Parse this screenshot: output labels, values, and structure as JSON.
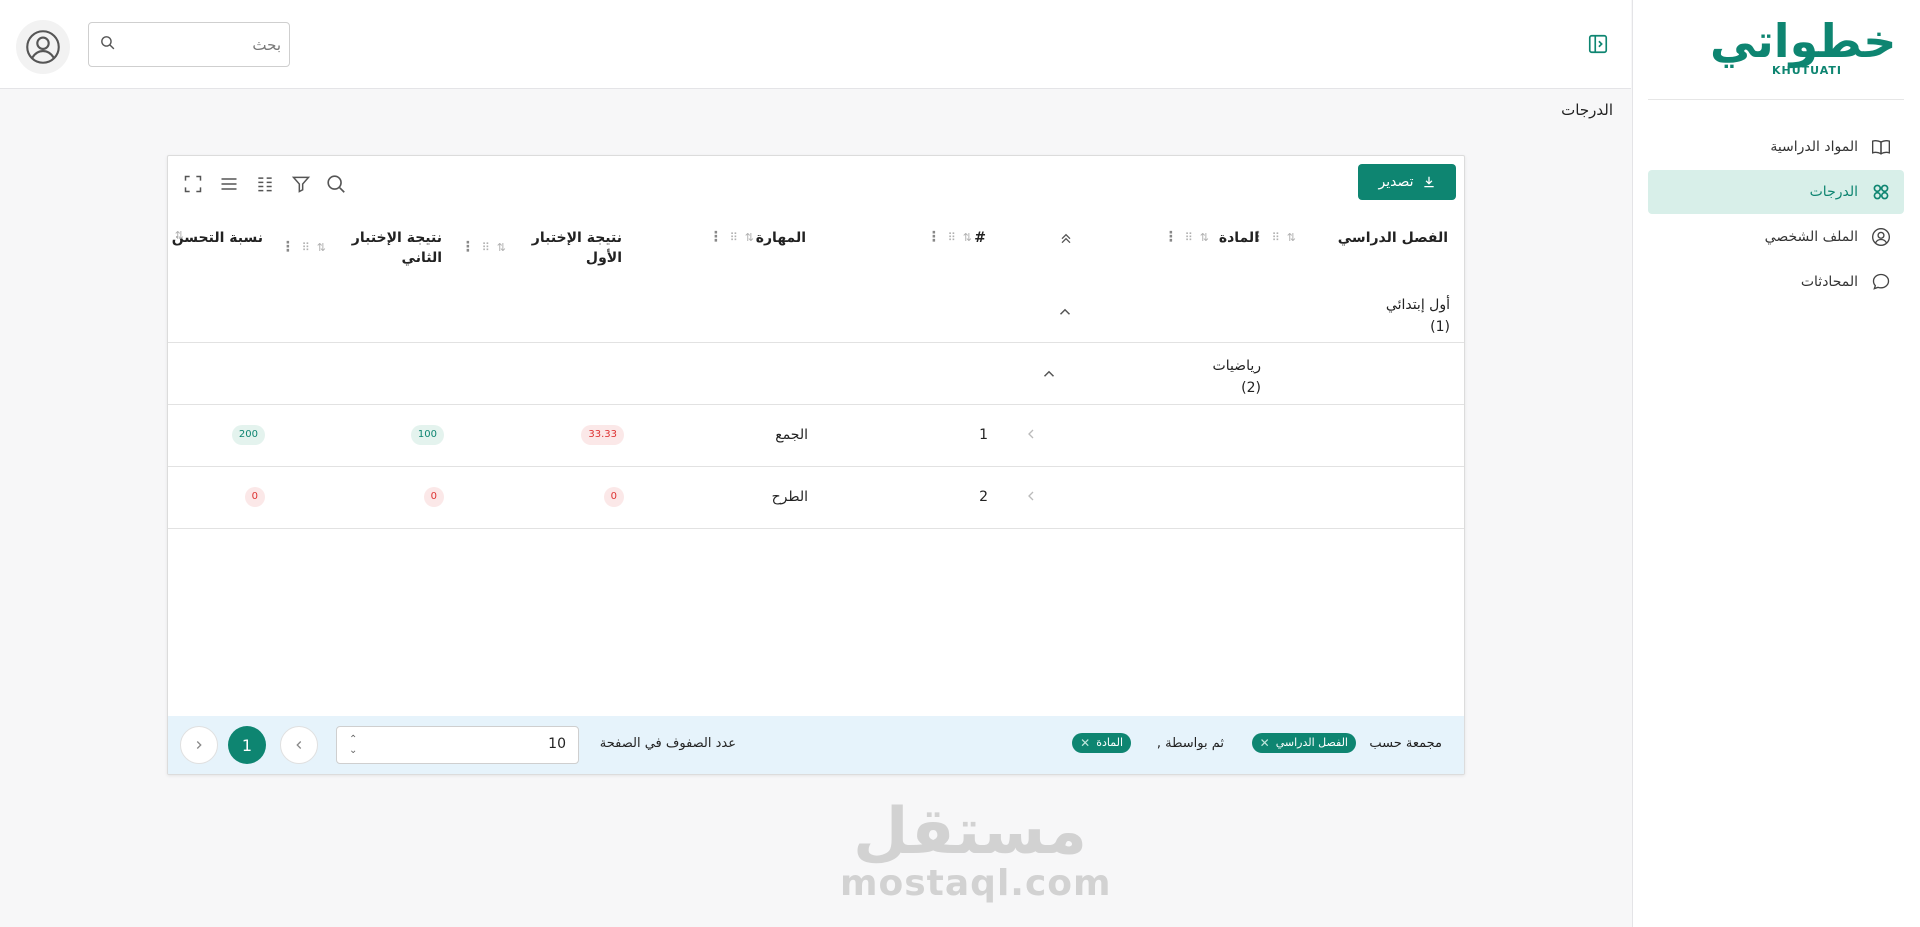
{
  "brand": {
    "logo_ar": "خطواتي",
    "logo_en": "KHUTUATI",
    "color": "#0e8571"
  },
  "sidebar": {
    "items": [
      {
        "label": "المواد الدراسية",
        "icon": "book-icon",
        "active": false
      },
      {
        "label": "الدرجات",
        "icon": "grades-icon",
        "active": true
      },
      {
        "label": "الملف الشخصي",
        "icon": "profile-icon",
        "active": false
      },
      {
        "label": "المحادثات",
        "icon": "chat-icon",
        "active": false
      }
    ]
  },
  "header": {
    "search_placeholder": "بحث"
  },
  "page": {
    "title": "الدرجات"
  },
  "table": {
    "export_label": "تصدير",
    "columns": {
      "semester": "الفصل الدراسي",
      "subject": "المادة",
      "number": "#",
      "skill": "المهارة",
      "test1_line1": "نتيجة الإختبار",
      "test1_line2": "الأول",
      "test2_line1": "نتيجة الإختبار",
      "test2_line2": "الثاني",
      "improvement": "نسبة التحسن"
    },
    "groups": {
      "level1": {
        "label": "أول إبتدائي",
        "count": "(1)"
      },
      "level2": {
        "label": "رياضيات",
        "count": "(2)"
      }
    },
    "rows": [
      {
        "number": "1",
        "skill": "الجمع",
        "test1": "33.33",
        "test2": "100",
        "improvement": "200"
      },
      {
        "number": "2",
        "skill": "الطرح",
        "test1": "0",
        "test2": "0",
        "improvement": "0"
      }
    ],
    "footer": {
      "grouped_by": "مجمعة حسب",
      "then_by": ", ثم بواسطة",
      "chip1": "الفصل الدراسي",
      "chip2": "المادة",
      "rows_per_page_label": "عدد الصفوف في الصفحة",
      "rows_per_page_value": "10",
      "current_page": "1"
    }
  },
  "watermark": {
    "ar": "مستقل",
    "en": "mostaql.com"
  }
}
